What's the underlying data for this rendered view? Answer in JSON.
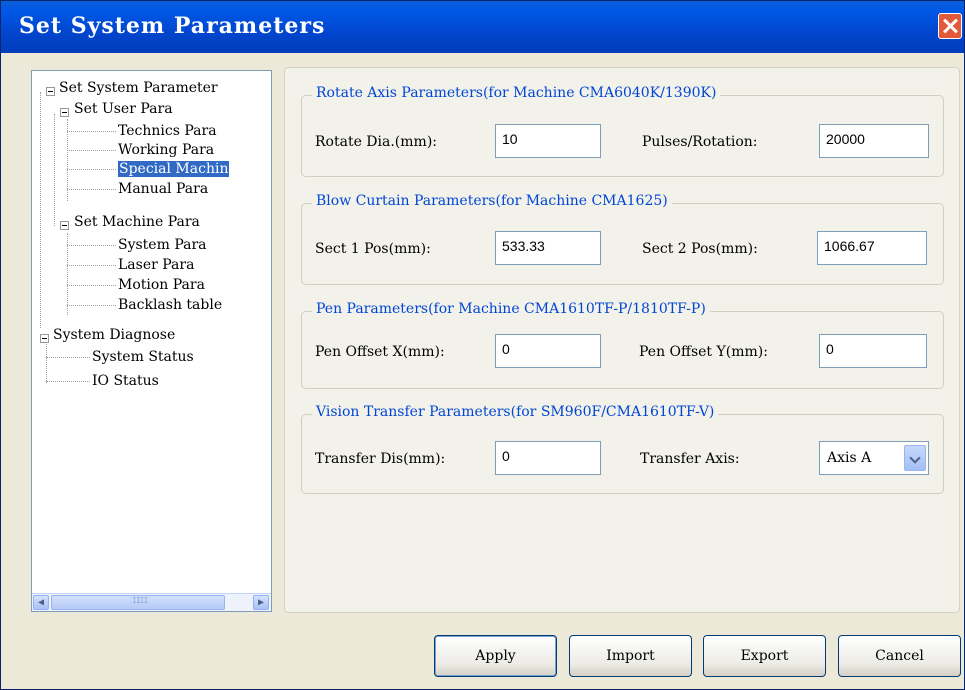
{
  "window": {
    "title": "Set System Parameters"
  },
  "tree": {
    "items": [
      {
        "label": "Set System Parameter"
      },
      {
        "label": "Set User Para"
      },
      {
        "label": "Technics Para"
      },
      {
        "label": "Working Para"
      },
      {
        "label": "Special Machin",
        "selected": true
      },
      {
        "label": "Manual Para"
      },
      {
        "label": "Set Machine Para"
      },
      {
        "label": "System Para"
      },
      {
        "label": "Laser Para"
      },
      {
        "label": "Motion Para"
      },
      {
        "label": "Backlash table"
      },
      {
        "label": "System Diagnose"
      },
      {
        "label": "System Status"
      },
      {
        "label": "IO Status"
      }
    ]
  },
  "groups": {
    "rotate": {
      "title": "Rotate Axis Parameters(for Machine CMA6040K/1390K)",
      "field1_label": "Rotate Dia.(mm):",
      "field1_value": "10",
      "field2_label": "Pulses/Rotation:",
      "field2_value": "20000"
    },
    "blow": {
      "title": "Blow Curtain Parameters(for Machine CMA1625)",
      "field1_label": "Sect 1 Pos(mm):",
      "field1_value": "533.33",
      "field2_label": "Sect 2 Pos(mm):",
      "field2_value": "1066.67"
    },
    "pen": {
      "title": "Pen Parameters(for Machine CMA1610TF-P/1810TF-P)",
      "field1_label": "Pen Offset X(mm):",
      "field1_value": "0",
      "field2_label": "Pen Offset Y(mm):",
      "field2_value": "0"
    },
    "vision": {
      "title": "Vision Transfer Parameters(for SM960F/CMA1610TF-V)",
      "field1_label": "Transfer Dis(mm):",
      "field1_value": "0",
      "field2_label": "Transfer Axis:",
      "field2_value": "Axis A"
    }
  },
  "buttons": {
    "apply": "Apply",
    "import": "Import",
    "export": "Export",
    "cancel": "Cancel"
  },
  "colors": {
    "titlebar": "#0146cf",
    "group_title": "#0046d5",
    "selection": "#316ac5",
    "close": "#e05a3a"
  }
}
